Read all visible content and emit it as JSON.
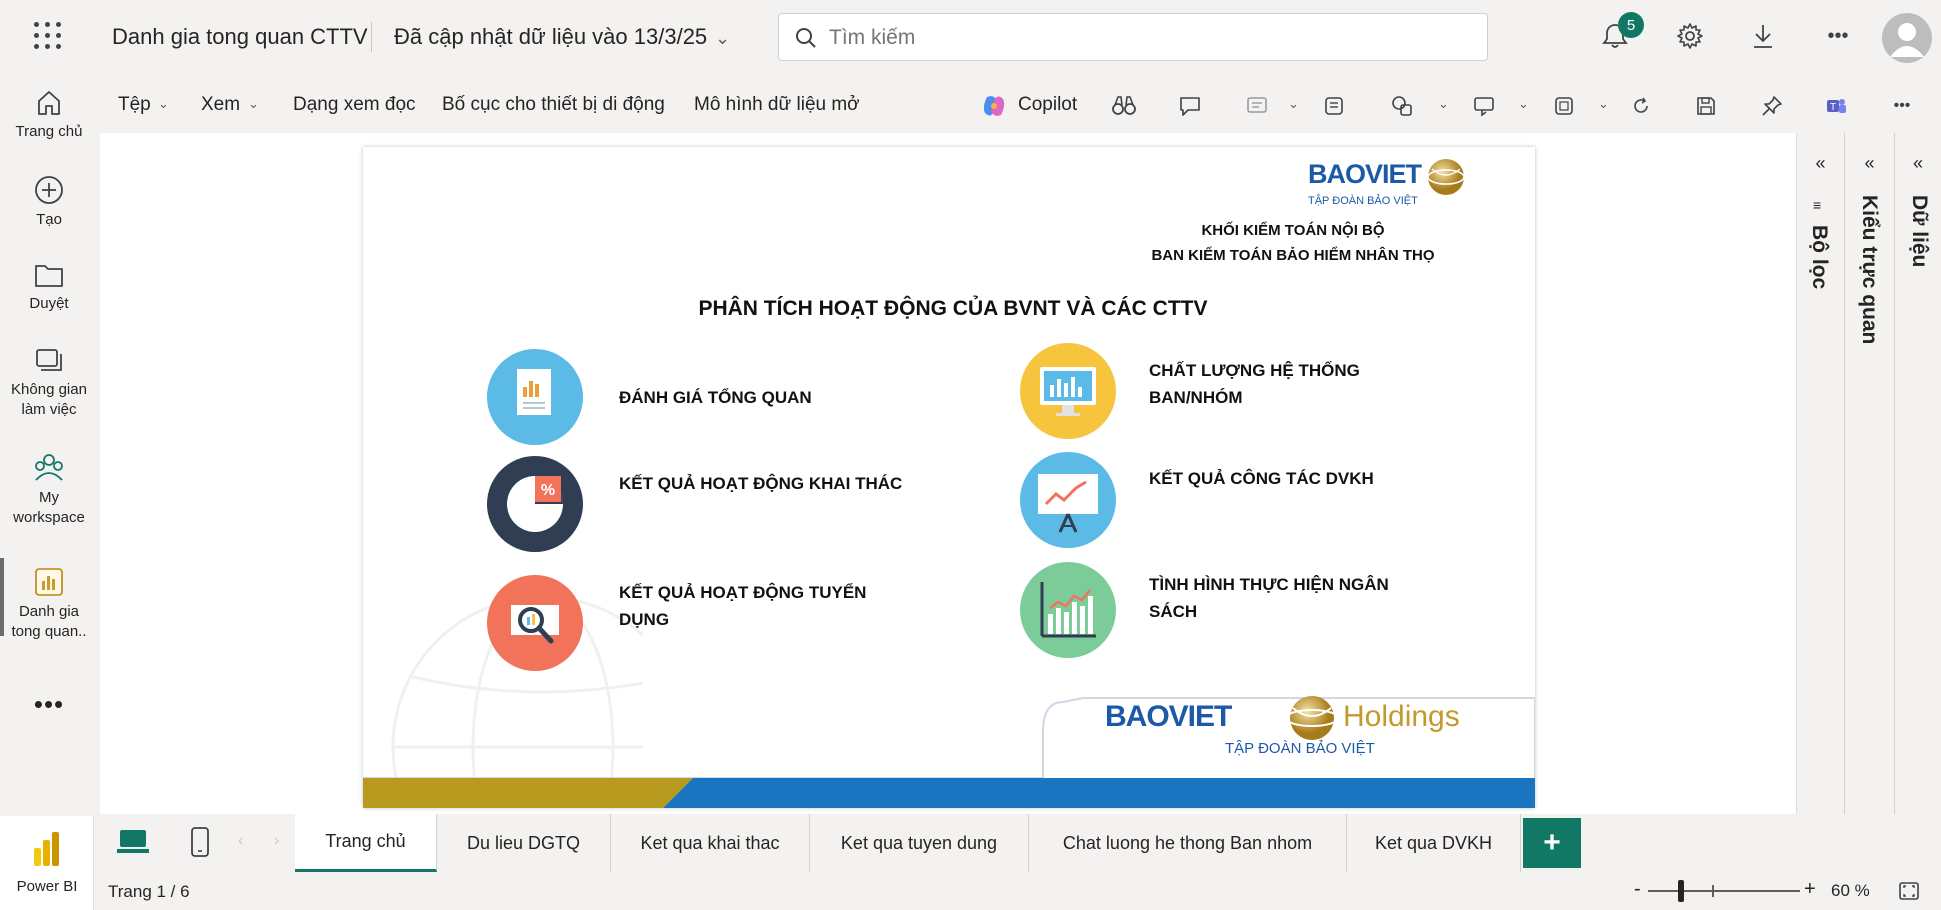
{
  "header": {
    "title": "Danh gia tong quan CTTV",
    "updated": "Đã cập nhật dữ liệu vào 13/3/25",
    "search_placeholder": "Tìm kiếm",
    "notification_count": "5"
  },
  "leftnav": {
    "items": [
      {
        "label": "Trang chủ",
        "icon": "home-icon"
      },
      {
        "label": "Tạo",
        "icon": "create-icon"
      },
      {
        "label": "Duyệt",
        "icon": "browse-folder-icon"
      },
      {
        "label": "Không gian làm việc",
        "icon": "workspaces-icon"
      },
      {
        "label": "My workspace",
        "icon": "my-workspace-icon"
      },
      {
        "label": "Danh gia tong quan..",
        "icon": "report-icon"
      }
    ],
    "more": "•••",
    "app_label": "Power BI"
  },
  "ribbon": {
    "file": "Tệp",
    "view": "Xem",
    "reading_view": "Dạng xem đọc",
    "mobile_layout": "Bố cục cho thiết bị di động",
    "open_data_model": "Mô hình dữ liệu mở",
    "copilot": "Copilot"
  },
  "report": {
    "logo_brand": "BAOVIET",
    "logo_sub": "TẬP ĐOÀN BẢO VIỆT",
    "org_line1": "KHỐI KIỂM TOÁN NỘI BỘ",
    "org_line2": "BAN KIỂM TOÁN BẢO HIỂM NHÂN THỌ",
    "heading": "PHÂN TÍCH HOẠT ĐỘNG CỦA BVNT VÀ CÁC CTTV",
    "menu": [
      {
        "label": "ĐÁNH GIÁ TỔNG QUAN",
        "icon": "document-chart-icon",
        "color": "#5bbbe6"
      },
      {
        "label": "KẾT QUẢ HOẠT ĐỘNG KHAI THÁC",
        "icon": "pie-percent-icon",
        "color": "#2f3e52"
      },
      {
        "label": "KẾT QUẢ HOẠT ĐỘNG TUYỂN DỤNG",
        "icon": "magnifier-chart-icon",
        "color": "#f0735a"
      },
      {
        "label": "CHẤT LƯỢNG HỆ THỐNG BAN/NHÓM",
        "icon": "monitor-chart-icon",
        "color": "#f7c43e"
      },
      {
        "label": "KẾT QUẢ CÔNG TÁC DVKH",
        "icon": "presentation-board-icon",
        "color": "#5bbbe6"
      },
      {
        "label": "TÌNH HÌNH THỰC HIỆN NGÂN SÁCH",
        "icon": "growth-chart-icon",
        "color": "#7ccc9a"
      }
    ],
    "footer_brand": "BAOVIET",
    "footer_holdings": "Holdings",
    "footer_sub": "TẬP ĐOÀN BẢO VIỆT"
  },
  "panes": {
    "filters": "Bộ lọc",
    "visualizations": "Kiểu trực quan",
    "data": "Dữ liệu"
  },
  "tabs": [
    {
      "label": "Trang chủ",
      "active": true
    },
    {
      "label": "Du lieu DGTQ",
      "active": false
    },
    {
      "label": "Ket qua khai thac",
      "active": false
    },
    {
      "label": "Ket qua tuyen dung",
      "active": false
    },
    {
      "label": "Chat luong he thong Ban nhom",
      "active": false
    },
    {
      "label": "Ket qua DVKH",
      "active": false
    }
  ],
  "status": {
    "page": "Trang 1 / 6",
    "zoom": "60 %"
  },
  "colors": {
    "accent": "#117865",
    "brand_blue": "#1c5aa8",
    "brand_gold": "#c39a2b"
  }
}
